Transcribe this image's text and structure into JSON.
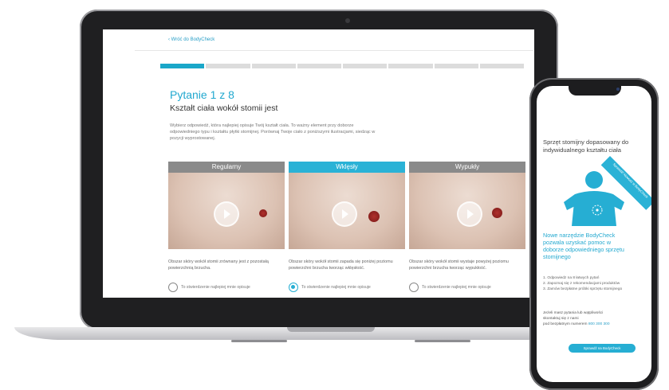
{
  "screen": {
    "back_link": "‹ Wróć do BodyCheck",
    "progress": {
      "current": 1,
      "total": 8
    },
    "question_number": "Pytanie 1 z 8",
    "question_title": "Kształt ciała wokół stomii jest",
    "description": "Wybierz odpowiedź, która najlepiej opisuje Twój kształt ciała. To ważny element przy doborze odpowiedniego typu i kształtu płytki stomijnej. Porównaj Twoje ciało z poniższymi ilustracjami, siedząc w pozycji wyprostowanej.",
    "radio_label": "To stwierdzenie najlepiej mnie opisuje",
    "cards": [
      {
        "label": "Regularny",
        "text": "Obszar skóry wokół stomii zrównany jest z pozostałą powierzchnią brzucha.",
        "selected": false
      },
      {
        "label": "Wklęsły",
        "text": "Obszar skóry wokół stomii zapada się poniżej poziomu powierzchni brzucha tworząc wklęsłość.",
        "selected": true
      },
      {
        "label": "Wypukły",
        "text": "Obszar skóry wokół stomii wystaje powyżej poziomu powierzchni brzucha tworząc wypukłość.",
        "selected": false
      }
    ]
  },
  "phone": {
    "heading": "Sprzęt stomijny dopasowany do indywidualnego kształtu ciała",
    "ribbon": "Sprawdź! Nowość w BodyCheck",
    "blue_text": "Nowe narzędzie BodyCheck pozwala uzyskać pomoc w doborze odpowiedniego sprzętu stomijnego",
    "steps": [
      "1. Odpowiedz na 8 łatwych pytań",
      "2. Zapoznaj się z rekomendacjami produktów",
      "3. Zamów bezpłatne próbki sprzętu stomijnego"
    ],
    "contact_line1": "Jeżeli masz pytania lub wątpliwości",
    "contact_line2": "skontaktuj się z nami",
    "contact_line3_prefix": "pod bezpłatnym numerem",
    "contact_phone": "800 300 300",
    "button": "Sprawdź na BodyCheck"
  },
  "colors": {
    "accent": "#26aed3",
    "inactive_tab": "#8a8a8a",
    "device_frame": "#1f1f21"
  }
}
